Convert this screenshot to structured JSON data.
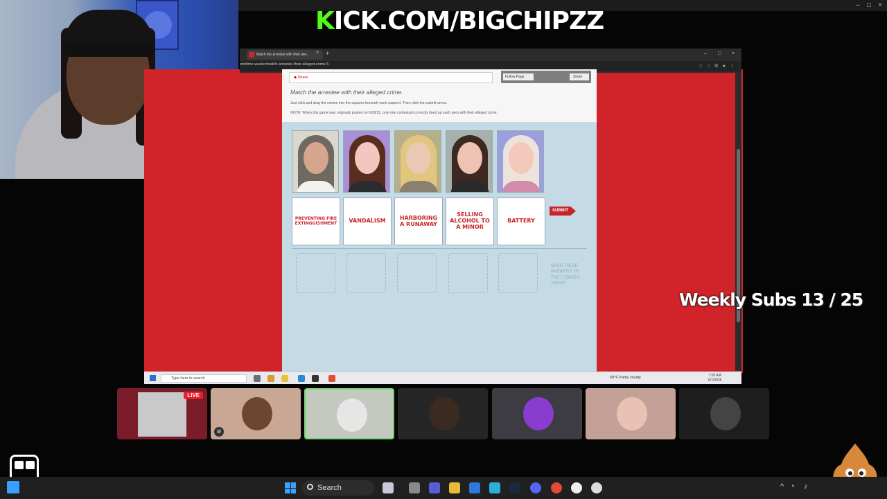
{
  "stream": {
    "banner_prefix": "K",
    "banner_rest": "ICK.COM/BIGCHIPZZ",
    "weekly_subs": "Weekly Subs  13 / 25"
  },
  "browser": {
    "tab_title": "Match the arrestee with their alle...",
    "url": "om/time-waster/match-arrestee-their-alleged-crime-5"
  },
  "page": {
    "share_label": "Share",
    "follow_label": "Follow Page",
    "share_label2": "Share",
    "heading": "Match the arrestee with their alleged crime.",
    "instructions": "Just click and drag the crimes into the squares beneath each suspect. Then click the submit arrow.",
    "note": "NOTE: When this game was originally posted on 6/29/11, only one contestant correctly lined up each perp with their alleged crime.",
    "submit_label": "SUBMIT",
    "crimes": [
      "PREVENTING FIRE EXTINGUISHMENT",
      "VANDALISM",
      "HARBORING A RUNAWAY",
      "SELLING ALCOHOL TO A MINOR",
      "BATTERY"
    ],
    "drag_note": "DRAG THESE ANSWERS TO THE ☐ BOXES ABOVE"
  },
  "laptop_taskbar": {
    "search_placeholder": "Type here to search",
    "weather": "69°F  Partly cloudy",
    "time": "7:03 AM",
    "date": "6/7/2025"
  },
  "participants": {
    "live_label": "LIVE"
  },
  "taskbar": {
    "search_label": "Search"
  },
  "icons": {
    "close": "×",
    "new_tab": "+",
    "minimize": "–",
    "maximize": "□"
  }
}
